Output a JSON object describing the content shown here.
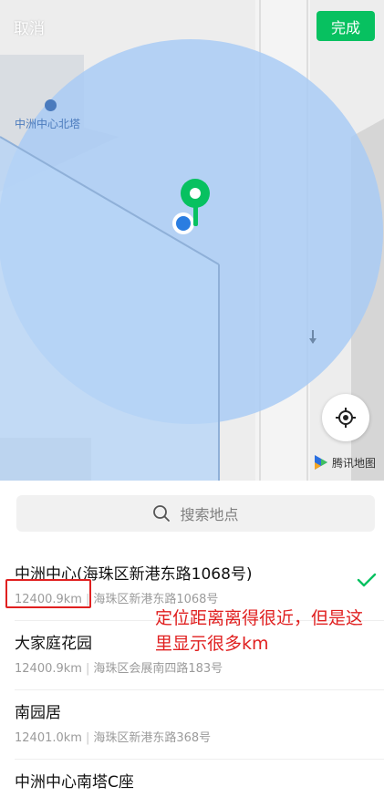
{
  "header": {
    "cancel_label": "取消",
    "done_label": "完成"
  },
  "map": {
    "poi_label": "中洲中心北塔",
    "brand_label": "腾讯地图",
    "colors": {
      "accuracy_circle": "#a9cbf4",
      "marker": "#07c160",
      "current_location": "#2a7de1"
    }
  },
  "search": {
    "placeholder": "搜索地点"
  },
  "places": [
    {
      "name": "中洲中心(海珠区新港东路1068号)",
      "distance": "12400.9km",
      "address": "海珠区新港东路1068号",
      "selected": true
    },
    {
      "name": "大家庭花园",
      "distance": "12400.9km",
      "address": "海珠区会展南四路183号",
      "selected": false
    },
    {
      "name": "南园居",
      "distance": "12401.0km",
      "address": "海珠区新港东路368号",
      "selected": false
    },
    {
      "name": "中洲中心南塔C座",
      "distance": "",
      "address": "",
      "selected": false
    }
  ],
  "annotation": {
    "text": "定位距离离得很近，但是这里显示很多km",
    "color": "#e02020"
  }
}
